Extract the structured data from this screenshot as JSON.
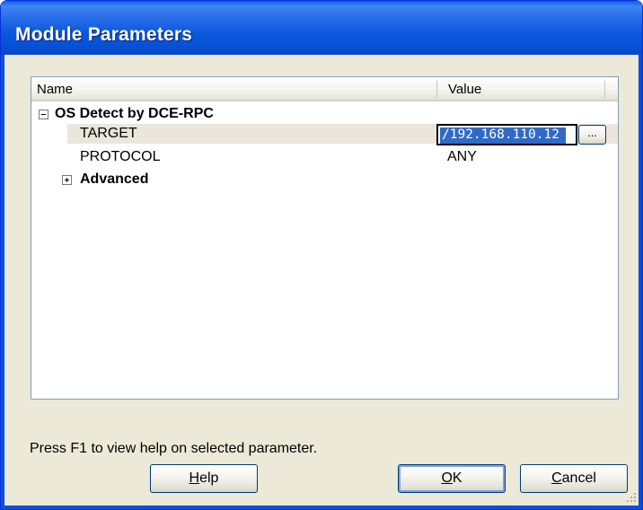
{
  "window": {
    "title": "Module Parameters"
  },
  "grid": {
    "columns": [
      "Name",
      "Value"
    ],
    "group": {
      "label": "OS Detect by DCE-RPC",
      "expanded": true
    },
    "rows": [
      {
        "name": "TARGET",
        "value": "/192.168.110.12",
        "selected": true,
        "editing": true
      },
      {
        "name": "PROTOCOL",
        "value": "ANY"
      }
    ],
    "advanced": {
      "label": "Advanced",
      "expanded": false
    },
    "browse_label": "..."
  },
  "status": {
    "text": "Press F1 to view help on selected parameter."
  },
  "buttons": {
    "help": {
      "pre": "",
      "mnemonic": "H",
      "post": "elp"
    },
    "ok": {
      "pre": "",
      "mnemonic": "O",
      "post": "K"
    },
    "cancel": {
      "pre": "",
      "mnemonic": "C",
      "post": "ancel"
    }
  },
  "colors": {
    "titlebar": "#0a5ee8",
    "selection": "#316ac5",
    "face": "#ece9d8"
  },
  "icons": [
    "collapse-icon",
    "expand-icon",
    "resize-grip-icon"
  ]
}
